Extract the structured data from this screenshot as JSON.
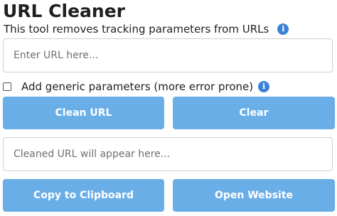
{
  "header": {
    "title": "URL Cleaner",
    "subtitle": "This tool removes tracking parameters from URLs",
    "info_icon": "i"
  },
  "input": {
    "placeholder": "Enter URL here...",
    "value": ""
  },
  "options": {
    "generic_params_label": "Add generic parameters (more error prone)",
    "generic_params_checked": false,
    "info_icon": "i"
  },
  "actions": {
    "clean_label": "Clean URL",
    "clear_label": "Clear",
    "copy_label": "Copy to Clipboard",
    "open_label": "Open Website"
  },
  "output": {
    "placeholder": "Cleaned URL will appear here..."
  },
  "colors": {
    "button_bg": "#6aaee8",
    "button_text": "#ffffff",
    "info_icon": "#3b82d6",
    "border": "#cfcfcf"
  }
}
